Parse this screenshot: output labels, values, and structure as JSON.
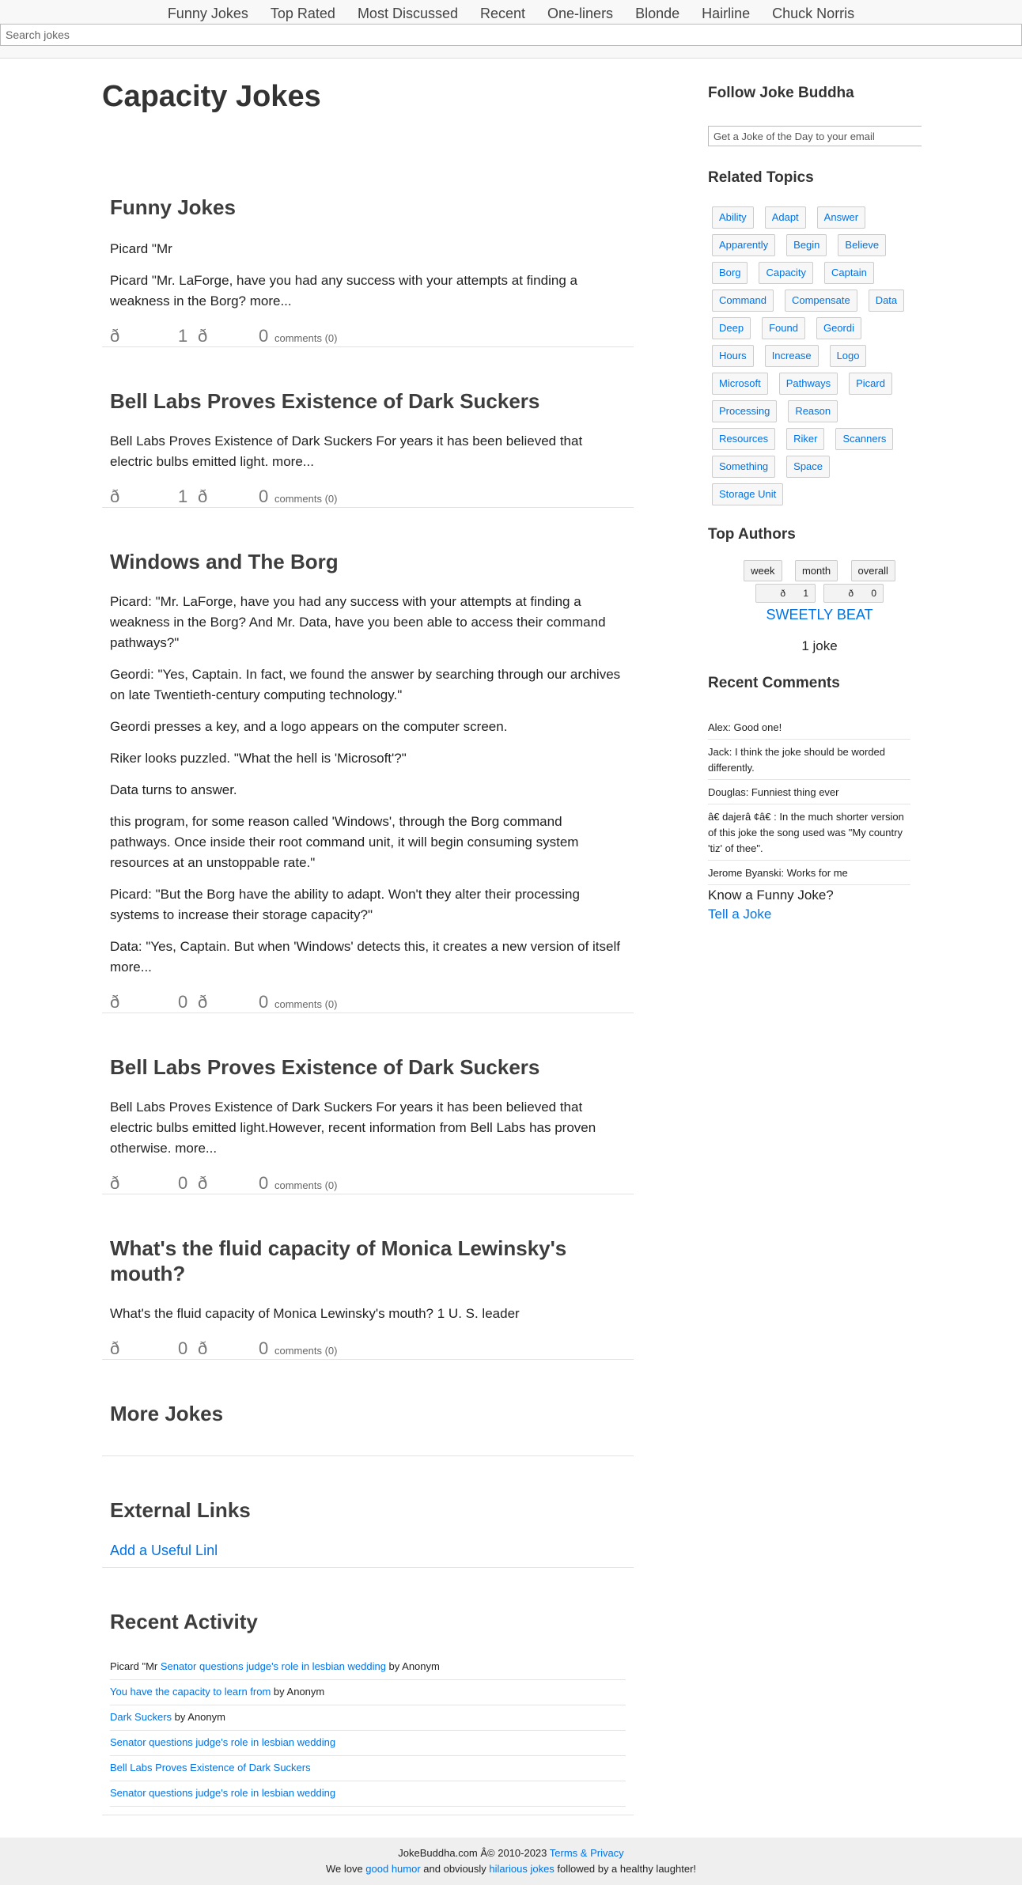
{
  "nav": [
    "Funny Jokes",
    "Top Rated",
    "Most Discussed",
    "Recent",
    "One-liners",
    "Blonde",
    "Hairline",
    "Chuck Norris"
  ],
  "search": {
    "placeholder": "Search jokes"
  },
  "page_title": "Capacity Jokes",
  "jokes": [
    {
      "title": "Funny Jokes",
      "paragraphs": [
        "Picard \"Mr",
        "Picard \"Mr. LaForge, have you had any success with your attempts at finding a weakness in the Borg? more..."
      ],
      "up_icon": "ð",
      "up": "1",
      "down_icon": "ð",
      "down": "0",
      "comments": "comments (0)"
    },
    {
      "title": "Bell Labs Proves Existence of Dark Suckers",
      "paragraphs": [
        "Bell Labs Proves Existence of Dark Suckers For years it has been believed that electric bulbs emitted light. more..."
      ],
      "up_icon": "ð",
      "up": "1",
      "down_icon": "ð",
      "down": "0",
      "comments": "comments (0)"
    },
    {
      "title": "Windows and The Borg",
      "paragraphs": [
        "Picard: \"Mr. LaForge, have you had any success with your attempts at finding a weakness in the Borg? And Mr. Data, have you been able to access their command pathways?\"",
        "Geordi: \"Yes, Captain. In fact, we found the answer by searching through our archives on late Twentieth-century computing technology.\"",
        "Geordi presses a key, and a logo appears on the computer screen.",
        "Riker looks puzzled. \"What the hell is 'Microsoft'?\"",
        "Data turns to answer.",
        "this program, for some reason called 'Windows', through the Borg command pathways. Once inside their root command unit, it will begin consuming system resources at an unstoppable rate.\"",
        "Picard: \"But the Borg have the ability to adapt. Won't they alter their processing systems to increase their storage capacity?\"",
        "Data: \"Yes, Captain. But when 'Windows' detects this, it creates a new version of itself more..."
      ],
      "up_icon": "ð",
      "up": "0",
      "down_icon": "ð",
      "down": "0",
      "comments": "comments (0)"
    },
    {
      "title": "Bell Labs Proves Existence of Dark Suckers",
      "paragraphs": [
        "Bell Labs Proves Existence of Dark Suckers For years it has been believed that electric bulbs emitted light.However, recent information from Bell Labs has proven otherwise. more..."
      ],
      "up_icon": "ð",
      "up": "0",
      "down_icon": "ð",
      "down": "0",
      "comments": "comments (0)"
    },
    {
      "title": "What's the fluid capacity of Monica Lewinsky's mouth?",
      "paragraphs": [
        "What's the fluid capacity of Monica Lewinsky's mouth? 1 U. S. leader"
      ],
      "up_icon": "ð",
      "up": "0",
      "down_icon": "ð",
      "down": "0",
      "comments": "comments (0)"
    }
  ],
  "more_jokes": {
    "title": "More Jokes"
  },
  "external_links": {
    "title": "External Links",
    "add_link": "Add a Useful Linl"
  },
  "recent_activity": {
    "title": "Recent Activity",
    "items": [
      {
        "prefix": "Picard \"Mr ",
        "link": "Senator questions judge's role in lesbian wedding",
        "suffix": " by Anonym"
      },
      {
        "prefix": "",
        "link": "You have the capacity to learn from",
        "suffix": " by Anonym"
      },
      {
        "prefix": "",
        "link": "Dark Suckers",
        "suffix": " by Anonym"
      },
      {
        "prefix": "",
        "link": "Senator questions judge's role in lesbian wedding",
        "suffix": ""
      },
      {
        "prefix": "",
        "link": "Bell Labs Proves Existence of Dark Suckers",
        "suffix": ""
      },
      {
        "prefix": "",
        "link": "Senator questions judge's role in lesbian wedding",
        "suffix": ""
      }
    ]
  },
  "sidebar": {
    "follow_title": "Follow Joke Buddha",
    "email_placeholder": "Get a Joke of the Day to your email",
    "related_title": "Related Topics",
    "tags": [
      "Ability",
      "Adapt",
      "Answer",
      "Apparently",
      "Begin",
      "Believe",
      "Borg",
      "Capacity",
      "Captain",
      "Command",
      "Compensate",
      "Data",
      "Deep",
      "Found",
      "Geordi",
      "Hours",
      "Increase",
      "Logo",
      "Microsoft",
      "Pathways",
      "Picard",
      "Processing",
      "Reason",
      "Resources",
      "Riker",
      "Scanners",
      "Something",
      "Space",
      "Storage Unit"
    ],
    "authors_title": "Top Authors",
    "periods": [
      "week",
      "month",
      "overall"
    ],
    "author_up_icon": "ð",
    "author_up": "1",
    "author_down_icon": "ð",
    "author_down": "0",
    "author_name": "SWEETLY BEAT",
    "author_count": "1 joke",
    "comments_title": "Recent Comments",
    "comments": [
      "Alex: Good one!",
      "Jack: I think the joke should be worded differently.",
      "Douglas: Funniest thing ever",
      "â€ dajerâ  ¢â€ : In the much shorter version of this joke the song used was \"My country 'tiz' of thee\".",
      "Jerome Byanski: Works for me"
    ],
    "know_funny": "Know a Funny Joke?",
    "tell_joke": "Tell a Joke"
  },
  "footer": {
    "copyright": "JokeBuddha.com Â© 2010-2023 ",
    "terms": "Terms & Privacy",
    "line2_a": "We love ",
    "good_humor": "good humor",
    "line2_b": " and obviously ",
    "hilarious": "hilarious jokes",
    "line2_c": " followed by a healthy laughter!"
  },
  "colors": {
    "link": "#0073e6",
    "heading": "#333333",
    "footer_bg": "#efefef"
  }
}
